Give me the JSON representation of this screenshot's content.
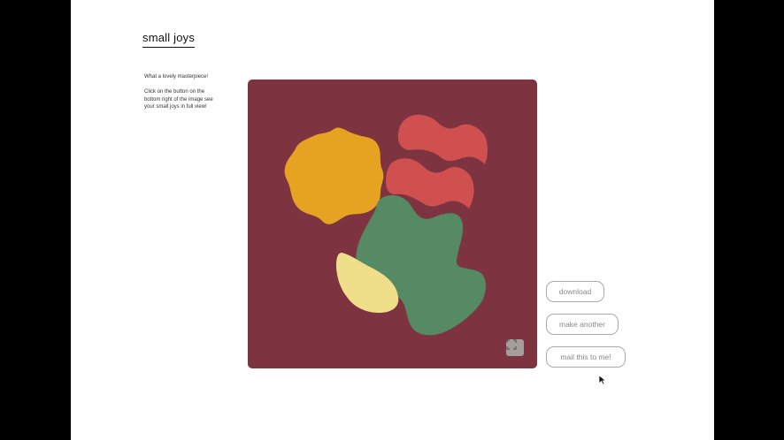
{
  "app": {
    "title": "small joys"
  },
  "intro": {
    "line1": "What a lovely masterpiece!",
    "line2": "Click on the button on the bottom right of the image see your small joys in full view!"
  },
  "artwork": {
    "background_color": "#7d3440",
    "shapes": [
      {
        "name": "sun-shape",
        "color": "#e5a321"
      },
      {
        "name": "red-wave-top",
        "color": "#d0504f"
      },
      {
        "name": "red-wave-bottom",
        "color": "#d0504f"
      },
      {
        "name": "green-blob",
        "color": "#568a65"
      },
      {
        "name": "yellow-leaf",
        "color": "#f0df8a"
      }
    ],
    "fullscreen_icon": "expand-icon"
  },
  "actions": {
    "download_label": "download",
    "make_another_label": "make another",
    "mail_label": "mail this to me!"
  }
}
